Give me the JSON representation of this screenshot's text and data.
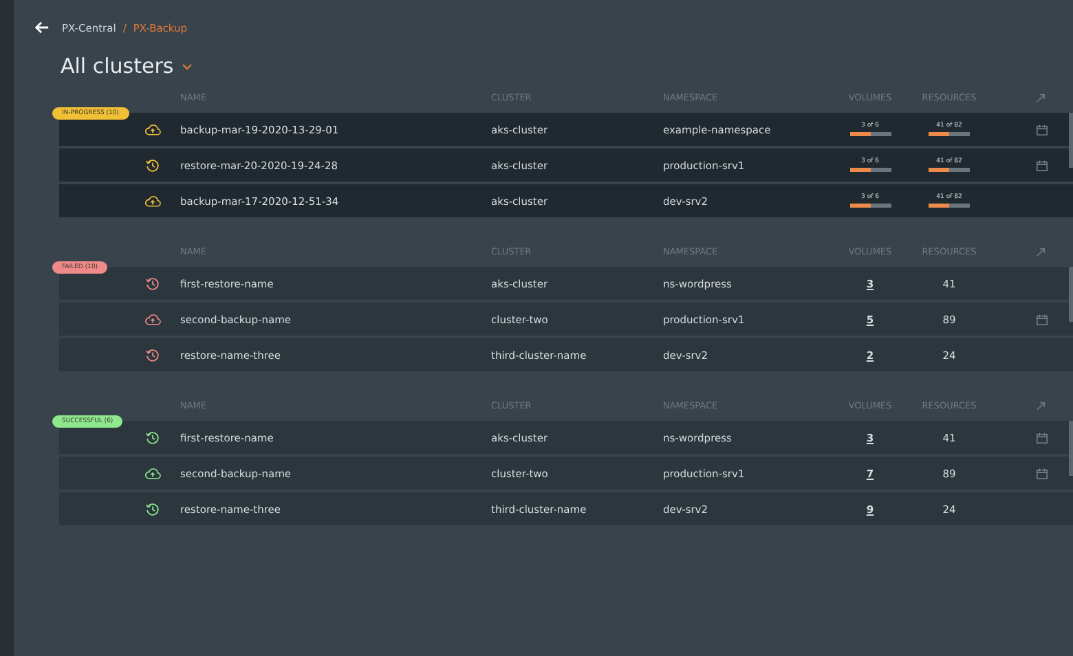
{
  "breadcrumb": [
    {
      "label": "PX-Central",
      "current": false
    },
    {
      "label": "PX-Backup",
      "current": true
    }
  ],
  "breadcrumb_separator": "/",
  "title": "All clusters",
  "sections": [
    {
      "status": "IN-PROGRESS (10)",
      "color": "#f2c037",
      "kind": "progress",
      "columns": [
        "NAME",
        "CLUSTER",
        "NAMESPACE",
        "VOLUMES",
        "RESOURCES"
      ],
      "rows": [
        {
          "kind": "backup",
          "name": "backup-mar-19-2020-13-29-01",
          "cluster": "aks-cluster",
          "namespace": "example-namespace",
          "volumes": {
            "text": "3 of 6",
            "level": 0.5
          },
          "resources": {
            "text": "41 of 82",
            "level": 0.5
          },
          "scheduled": true
        },
        {
          "kind": "restore",
          "name": "restore-mar-20-2020-19-24-28",
          "cluster": "aks-cluster",
          "namespace": "production-srv1",
          "volumes": {
            "text": "3 of 6",
            "level": 0.5
          },
          "resources": {
            "text": "41 of 82",
            "level": 0.5
          },
          "scheduled": true
        },
        {
          "kind": "backup",
          "name": "backup-mar-17-2020-12-51-34",
          "cluster": "aks-cluster",
          "namespace": "dev-srv2",
          "volumes": {
            "text": "3 of 6",
            "level": 0.5
          },
          "resources": {
            "text": "41 of 82",
            "level": 0.5
          },
          "scheduled": false
        }
      ]
    },
    {
      "status": "FAILED (10)",
      "color": "#f08a8a",
      "kind": "count",
      "columns": [
        "NAME",
        "CLUSTER",
        "NAMESPACE",
        "VOLUMES",
        "RESOURCES"
      ],
      "rows": [
        {
          "kind": "restore",
          "name": "first-restore-name",
          "cluster": "aks-cluster",
          "namespace": "ns-wordpress",
          "volumes": {
            "text": "3"
          },
          "resources": {
            "text": "41"
          },
          "scheduled": false
        },
        {
          "kind": "backup",
          "name": "second-backup-name",
          "cluster": "cluster-two",
          "namespace": "production-srv1",
          "volumes": {
            "text": "5"
          },
          "resources": {
            "text": "89"
          },
          "scheduled": true
        },
        {
          "kind": "restore",
          "name": "restore-name-three",
          "cluster": "third-cluster-name",
          "namespace": "dev-srv2",
          "volumes": {
            "text": "2"
          },
          "resources": {
            "text": "24"
          },
          "scheduled": false
        }
      ]
    },
    {
      "status": "SUCCESSFUL (6)",
      "color": "#8ee88e",
      "kind": "count",
      "columns": [
        "NAME",
        "CLUSTER",
        "NAMESPACE",
        "VOLUMES",
        "RESOURCES"
      ],
      "rows": [
        {
          "kind": "restore",
          "name": "first-restore-name",
          "cluster": "aks-cluster",
          "namespace": "ns-wordpress",
          "volumes": {
            "text": "3"
          },
          "resources": {
            "text": "41"
          },
          "scheduled": true
        },
        {
          "kind": "backup",
          "name": "second-backup-name",
          "cluster": "cluster-two",
          "namespace": "production-srv1",
          "volumes": {
            "text": "7"
          },
          "resources": {
            "text": "89"
          },
          "scheduled": true
        },
        {
          "kind": "restore",
          "name": "restore-name-three",
          "cluster": "third-cluster-name",
          "namespace": "dev-srv2",
          "volumes": {
            "text": "9"
          },
          "resources": {
            "text": "24"
          },
          "scheduled": false
        }
      ]
    }
  ]
}
